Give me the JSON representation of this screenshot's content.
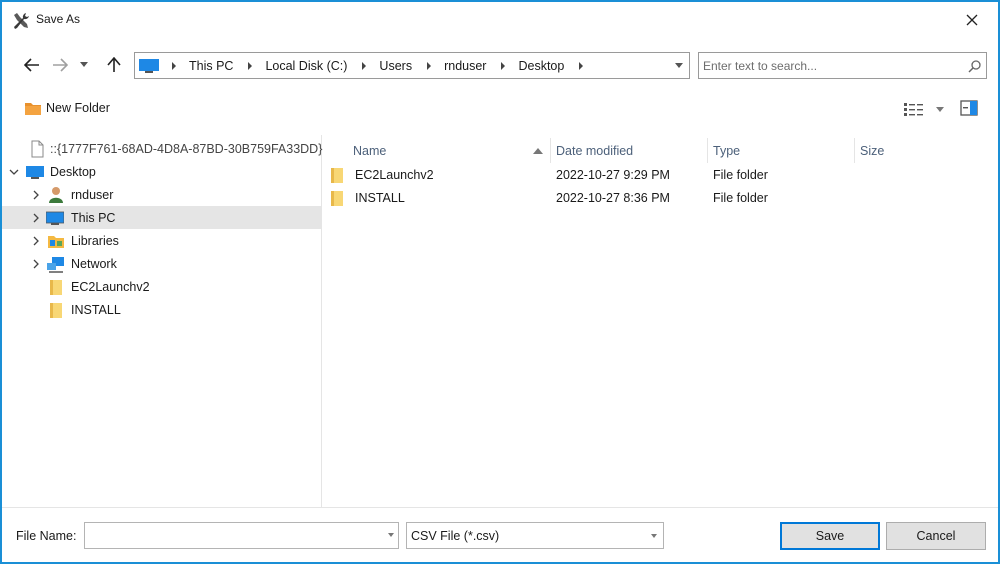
{
  "window": {
    "title": "Save As"
  },
  "nav": {
    "breadcrumbs": [
      "This PC",
      "Local Disk (C:)",
      "Users",
      "rnduser",
      "Desktop"
    ],
    "search_placeholder": "Enter text to search..."
  },
  "toolbar": {
    "new_folder_label": "New Folder"
  },
  "tree": {
    "items": [
      {
        "label": "::{1777F761-68AD-4D8A-87BD-30B759FA33DD}",
        "icon": "document-icon",
        "expander": "none",
        "indent": 0
      },
      {
        "label": "Desktop",
        "icon": "desktop-icon",
        "expander": "expanded",
        "indent": 0
      },
      {
        "label": "rnduser",
        "icon": "user-icon",
        "expander": "collapsed",
        "indent": 1
      },
      {
        "label": "This PC",
        "icon": "computer-icon",
        "expander": "collapsed",
        "indent": 1,
        "selected": true
      },
      {
        "label": "Libraries",
        "icon": "libraries-icon",
        "expander": "collapsed",
        "indent": 1
      },
      {
        "label": "Network",
        "icon": "network-icon",
        "expander": "collapsed",
        "indent": 1
      },
      {
        "label": "EC2Launchv2",
        "icon": "folder-icon",
        "expander": "none",
        "indent": 1
      },
      {
        "label": "INSTALL",
        "icon": "folder-icon",
        "expander": "none",
        "indent": 1
      }
    ]
  },
  "list": {
    "columns": [
      "Name",
      "Date modified",
      "Type",
      "Size"
    ],
    "sort_column": "Name",
    "rows": [
      {
        "name": "EC2Launchv2",
        "date": "2022-10-27 9:29 PM",
        "type": "File folder",
        "size": ""
      },
      {
        "name": "INSTALL",
        "date": "2022-10-27 8:36 PM",
        "type": "File folder",
        "size": ""
      }
    ]
  },
  "bottom": {
    "file_name_label": "File Name:",
    "file_name_value": "",
    "file_type": "CSV File (*.csv)",
    "save_label": "Save",
    "cancel_label": "Cancel"
  },
  "colors": {
    "accent": "#1a8fd6",
    "selection": "#e5e5e5",
    "folder": "#f8d775",
    "header_text": "#4c607a"
  }
}
